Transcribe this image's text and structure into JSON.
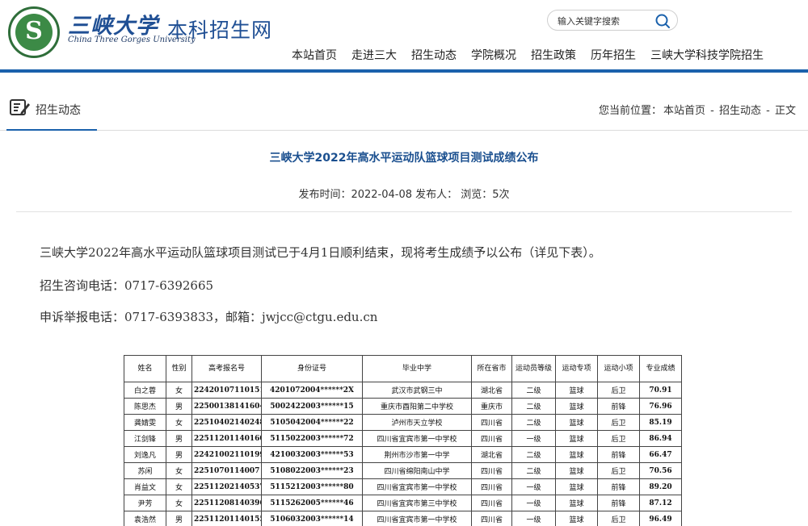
{
  "header": {
    "logo_cn": "三峡大学",
    "logo_en": "China Three Gorges University",
    "site_name": "本科招生网",
    "search_placeholder": "输入关键字搜索",
    "nav": [
      "本站首页",
      "走进三大",
      "招生动态",
      "学院概况",
      "招生政策",
      "历年招生",
      "三峡大学科技学院招生"
    ]
  },
  "section": {
    "title": "招生动态",
    "breadcrumb_label": "您当前位置：",
    "breadcrumb": [
      "本站首页",
      "招生动态",
      "正文"
    ],
    "breadcrumb_sep": " - "
  },
  "article": {
    "title": "三峡大学2022年高水平运动队篮球项目测试成绩公布",
    "meta": "发布时间：2022-04-08 发布人： 浏览：5次",
    "paragraphs": [
      "三峡大学2022年高水平运动队篮球项目测试已于4月1日顺利结束，现将考生成绩予以公布（详见下表）。",
      "招生咨询电话：0717-6392665",
      "申诉举报电话：0717-6393833，邮箱：jwjcc@ctgu.edu.cn"
    ]
  },
  "table": {
    "headers": [
      "姓名",
      "性别",
      "高考报名号",
      "身份证号",
      "毕业中学",
      "所在省市",
      "运动员等级",
      "运动专项",
      "运动小项",
      "专业成绩"
    ],
    "rows": [
      [
        "白之蓉",
        "女",
        "22420107110151",
        "4201072004******2X",
        "武汉市武钢三中",
        "湖北省",
        "二级",
        "篮球",
        "后卫",
        "70.91"
      ],
      [
        "陈思杰",
        "男",
        "22500138141604",
        "5002422003******15",
        "重庆市酉阳第二中学校",
        "重庆市",
        "二级",
        "篮球",
        "前锋",
        "76.96"
      ],
      [
        "龚婧雯",
        "女",
        "22510402140248",
        "5105042004******22",
        "泸州市天立学校",
        "四川省",
        "二级",
        "篮球",
        "后卫",
        "85.19"
      ],
      [
        "江剑锋",
        "男",
        "22511201140160",
        "5115022003******72",
        "四川省宜宾市第一中学校",
        "四川省",
        "一级",
        "篮球",
        "后卫",
        "86.94"
      ],
      [
        "刘逸凡",
        "男",
        "22421002110199",
        "4210032003******53",
        "荆州市沙市第一中学",
        "湖北省",
        "二级",
        "篮球",
        "前锋",
        "66.47"
      ],
      [
        "苏闲",
        "女",
        "2251070114007",
        "5108022003******23",
        "四川省绵阳南山中学",
        "四川省",
        "二级",
        "篮球",
        "后卫",
        "70.56"
      ],
      [
        "肖益文",
        "女",
        "22511202140537",
        "5115212003******80",
        "四川省宜宾市第一中学校",
        "四川省",
        "一级",
        "篮球",
        "前锋",
        "89.20"
      ],
      [
        "尹芳",
        "女",
        "22511208140396",
        "5115262005******46",
        "四川省宜宾市第三中学校",
        "四川省",
        "一级",
        "篮球",
        "前锋",
        "87.12"
      ],
      [
        "袁浩然",
        "男",
        "22511201140155",
        "5106032003******14",
        "四川省宜宾市第一中学校",
        "四川省",
        "一级",
        "篮球",
        "后卫",
        "96.49"
      ]
    ]
  },
  "colors": {
    "brand_blue": "#1a61ac",
    "title_blue": "#1a4f8f",
    "logo_green": "#3c8a46"
  }
}
